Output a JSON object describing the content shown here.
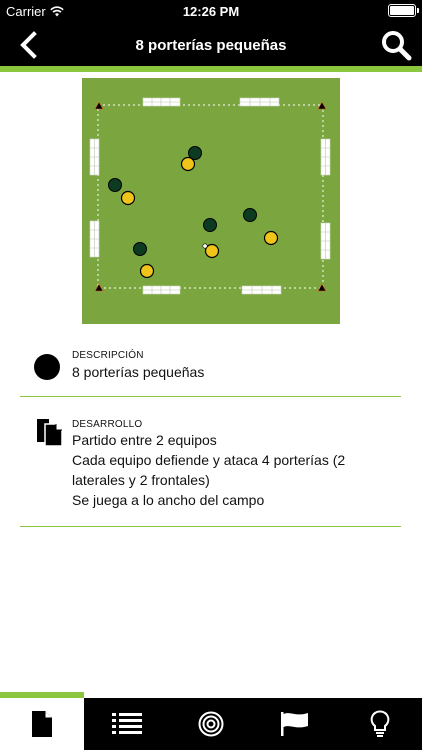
{
  "status_bar": {
    "carrier": "Carrier",
    "time": "12:26 PM"
  },
  "header": {
    "title": "8 porterías pequeñas"
  },
  "diagram": {
    "field_color": "#7aa53f",
    "team_a_color": "#0d3b22",
    "team_b_color": "#f0c419"
  },
  "description": {
    "label": "DESCRIPCIÓN",
    "value": "8 porterías pequeñas"
  },
  "development": {
    "label": "DESARROLLO",
    "lines": [
      "Partido entre 2 equipos",
      "Cada equipo defiende y ataca 4 porterías (2 laterales y 2 frontales)",
      "Se juega a lo ancho del campo"
    ]
  },
  "tabs": [
    {
      "name": "document-icon",
      "active": true
    },
    {
      "name": "list-icon",
      "active": false
    },
    {
      "name": "target-icon",
      "active": false
    },
    {
      "name": "flag-icon",
      "active": false
    },
    {
      "name": "lightbulb-icon",
      "active": false
    }
  ],
  "colors": {
    "accent": "#8cc63f",
    "bar": "#000000"
  }
}
